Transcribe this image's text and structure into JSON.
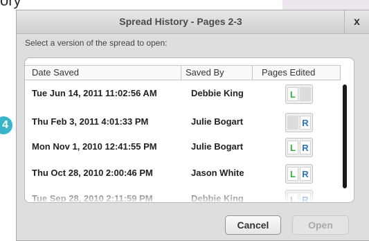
{
  "background": {
    "heading_fragment": "ory",
    "marker_number": "4",
    "marker_color": "#3bb3c9"
  },
  "dialog": {
    "title": "Spread History - Pages 2-3",
    "close_label": "x",
    "prompt": "Select a version of the spread to open:",
    "columns": [
      "Date Saved",
      "Saved By",
      "Pages Edited"
    ],
    "rows": [
      {
        "date": "Tue Jun 14, 2011 11:02:56 AM",
        "by": "Debbie King",
        "left": "L",
        "right": "",
        "left_edited": true,
        "right_edited": false
      },
      {
        "date": "Thu Feb 3, 2011 4:01:33 PM",
        "by": "Julie Bogart",
        "left": "",
        "right": "R",
        "left_edited": false,
        "right_edited": true
      },
      {
        "date": "Mon Nov 1, 2010 12:41:55 PM",
        "by": "Julie Bogart",
        "left": "L",
        "right": "R",
        "left_edited": true,
        "right_edited": true
      },
      {
        "date": "Thu Oct 28, 2010 2:00:46 PM",
        "by": "Jason White",
        "left": "L",
        "right": "R",
        "left_edited": true,
        "right_edited": true
      },
      {
        "date": "Tue Sep 28, 2010 2:11:59 PM",
        "by": "Debbie King",
        "left": "L",
        "right": "R",
        "left_edited": true,
        "right_edited": true
      }
    ],
    "buttons": {
      "cancel": "Cancel",
      "open": "Open"
    },
    "colors": {
      "L": "#3aa644",
      "R": "#2b73c0"
    }
  }
}
